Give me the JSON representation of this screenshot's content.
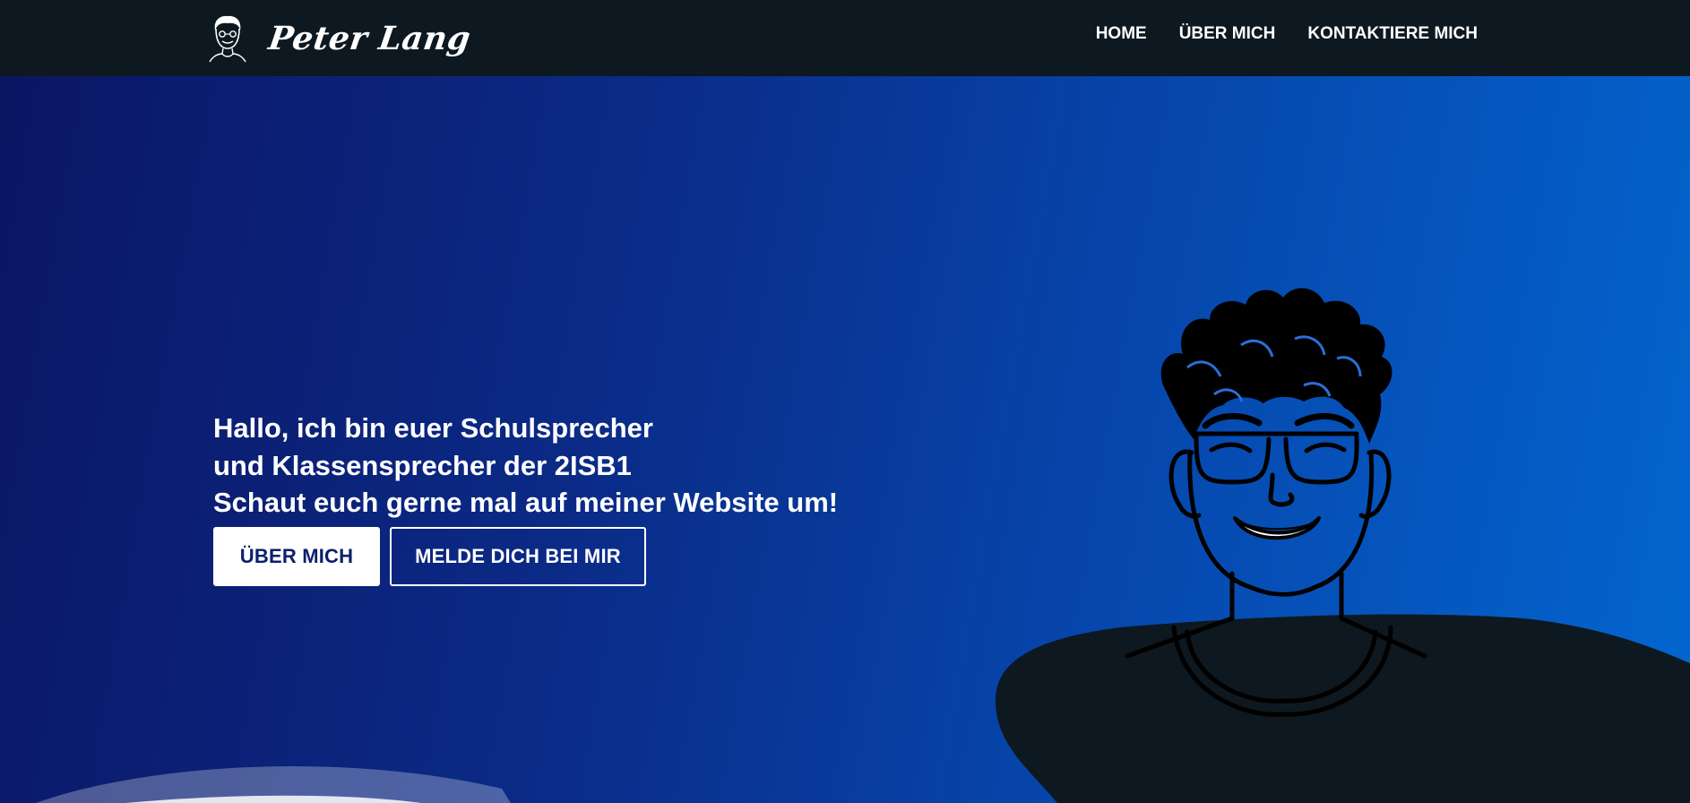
{
  "header": {
    "brand_name": "Peter Lang",
    "nav": [
      {
        "label": "HOME"
      },
      {
        "label": "ÜBER MICH"
      },
      {
        "label": "KONTAKTIERE MICH"
      }
    ]
  },
  "hero": {
    "lines": [
      "Hallo, ich bin euer Schulsprecher",
      "und Klassensprecher der 2ISB1",
      "Schaut euch gerne mal auf meiner Website um!"
    ],
    "primary_button": "ÜBER MICH",
    "secondary_button": "MELDE DICH BEI MIR"
  },
  "colors": {
    "navbar_bg": "#0d1820",
    "hero_gradient_start": "#0b1664",
    "hero_gradient_end": "#0366d0",
    "button_text": "#0b1f6e",
    "shirt": "#0d1820"
  },
  "icons": [
    "avatar-logo-icon",
    "person-illustration"
  ]
}
